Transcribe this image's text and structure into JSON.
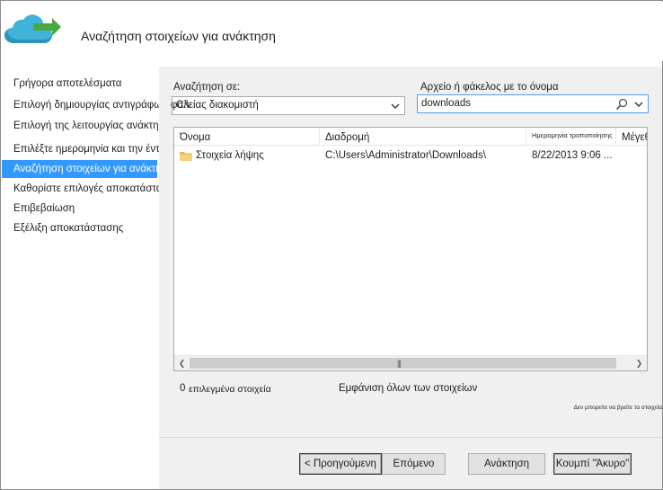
{
  "window": {
    "title": "Αναζήτηση στοιχείων για ανάκτηση"
  },
  "steps": [
    {
      "label": "Γρήγορα αποτελέσματα"
    },
    {
      "label": "Επιλογή δημιουργίας αντιγράφων ασφαλείας διακομιστή"
    },
    {
      "label": "Επιλογή της λειτουργίας ανάκτησης"
    },
    {
      "label": "Επιλέξτε ημερομηνία και την ένταση"
    },
    {
      "label": "Αναζήτηση στοιχείων για ανάκτηση"
    },
    {
      "label": "Καθορίστε επιλογές αποκατάστασης"
    },
    {
      "label": "Επιβεβαίωση"
    },
    {
      "label": "Εξέλιξη αποκατάστασης"
    }
  ],
  "search_in": {
    "label": "Αναζήτηση σε:",
    "value": "C:\\",
    "overlap_text": "φαλείας διακομιστή"
  },
  "name_search": {
    "label": "Αρχείο ή φάκελος με το όνομα",
    "value": "downloads"
  },
  "table": {
    "columns": [
      "Όνομα",
      "Διαδρομή",
      "Ημερομηνία τροποποίησης",
      "Μέγεθος"
    ],
    "rows": [
      {
        "name": "Στοιχεία λήψης",
        "path": "C:\\Users\\Administrator\\Downloads\\",
        "date": "8/22/2013 9:06 ..."
      }
    ]
  },
  "status": {
    "count": "0",
    "selected_label": "επιλεγμένα στοιχεία",
    "show_all": "Εμφάνιση όλων των στοιχείων"
  },
  "hint": "Δεν μπορείτε να βρείτε τα στοιχεία",
  "buttons": {
    "previous": "< Προηγούμενη",
    "next": "Επόμενο",
    "recover": "Ανάκτηση",
    "cancel": "Κουμπί \"Άκυρο\""
  },
  "colors": {
    "accent": "#3399ff",
    "content_bg": "#f0f0f0",
    "logo_cloud": "#3fb3d9",
    "logo_arrow": "#4aa843"
  },
  "icons": {
    "logo": "cloud-backup-icon",
    "search": "magnifier-icon",
    "dropdown": "chevron-down-icon",
    "folder": "folder-icon"
  }
}
